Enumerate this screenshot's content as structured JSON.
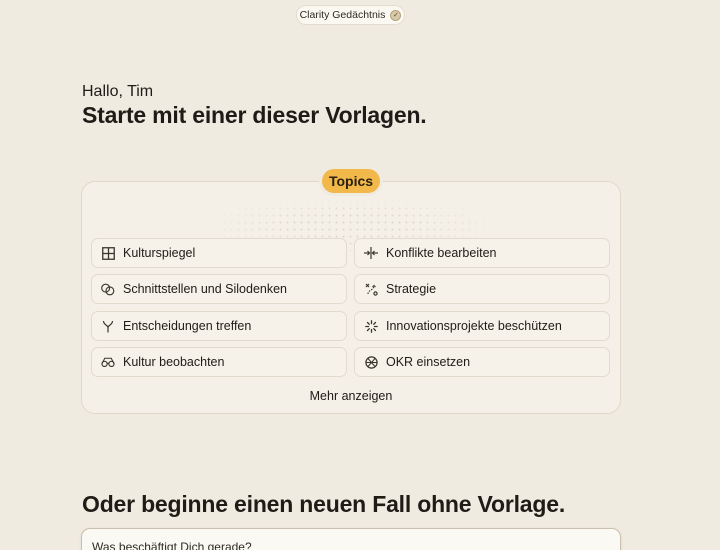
{
  "memory": {
    "label": "Clarity Gedächtnis",
    "icon": "check-circle-icon"
  },
  "greeting": "Hallo, Tim",
  "headline": "Starte mit einer dieser Vorlagen.",
  "topics": {
    "badge": "Topics",
    "items": [
      {
        "label": "Kulturspiegel",
        "icon": "grid-icon"
      },
      {
        "label": "Konflikte bearbeiten",
        "icon": "converge-arrows-icon"
      },
      {
        "label": "Schnittstellen und Silodenken",
        "icon": "overlap-circles-icon"
      },
      {
        "label": "Strategie",
        "icon": "strategy-icon"
      },
      {
        "label": "Entscheidungen treffen",
        "icon": "fork-icon"
      },
      {
        "label": "Innovationsprojekte beschützen",
        "icon": "spark-icon"
      },
      {
        "label": "Kultur beobachten",
        "icon": "glasses-icon"
      },
      {
        "label": "OKR einsetzen",
        "icon": "target-icon"
      }
    ],
    "more_label": "Mehr anzeigen"
  },
  "new_case": {
    "heading": "Oder beginne einen neuen Fall ohne Vorlage.",
    "placeholder": "Was beschäftigt Dich gerade?"
  }
}
